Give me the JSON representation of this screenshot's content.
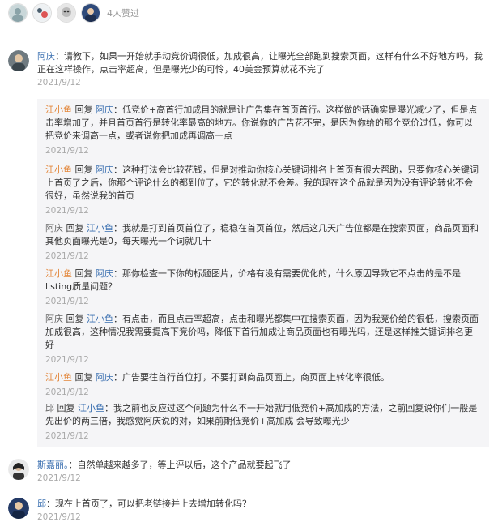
{
  "liked": {
    "text": "4人赞过",
    "avatars": [
      "avatar-1",
      "avatar-2",
      "avatar-3",
      "avatar-4"
    ]
  },
  "comments": [
    {
      "author": "阿庆",
      "text": "：请教下，如果一开始就手动竞价调很低，加成很高，让曝光全部跑到搜索页面，这样有什么不好地方吗，我正在这样操作，点击率超高，但是曝光少的可怜，40美金预算就花不完了",
      "date": "2021/9/12"
    },
    {
      "author": "斯嘉丽。",
      "text": "：自然单越来越多了，等上评以后，这个产品就要起飞了",
      "date": "2021/9/12"
    },
    {
      "author": "邱",
      "text": "：现在上首页了，可以把老链接并上去增加转化吗？",
      "date": "2021/9/12"
    }
  ],
  "replies": [
    {
      "from": "江小鱼",
      "verb": "回复",
      "to": "阿庆",
      "text": "：低竞价+高首行加成目的就是让广告集在首页首行。这样做的话确实是曝光减少了，但是点击率增加了，并且首页首行是转化率最高的地方。你说你的广告花不完，是因为你给的那个竞价过低，你可以把竞价来调高一点，或者说你把加成再调高一点",
      "date": "2021/9/12"
    },
    {
      "from": "江小鱼",
      "verb": "回复",
      "to": "阿庆",
      "text": "：这种打法会比较花钱，但是对推动你核心关键词排名上首页有很大帮助，只要你核心关键词上首页了之后，你那个评论什么的都到位了，它的转化就不会差。我的现在这个品就是因为没有评论转化不会很好，虽然说我的首页",
      "date": "2021/9/12"
    },
    {
      "from": "阿庆",
      "verb": "回复",
      "to": "江小鱼",
      "text": "：我就是打到首页首位了，稳稳在首页首位，然后这几天广告位都是在搜索页面，商品页面和其他页面曝光是0，每天曝光一个词就几十",
      "date": "2021/9/12"
    },
    {
      "from": "江小鱼",
      "verb": "回复",
      "to": "阿庆",
      "text": "：那你检查一下你的标题图片，价格有没有需要优化的，什么原因导致它不点击的是不是listing质量问题？",
      "date": "2021/9/12"
    },
    {
      "from": "阿庆",
      "verb": "回复",
      "to": "江小鱼",
      "text": "：有点击，而且点击率超高，点击和曝光都集中在搜索页面，因为我竞价给的很低，搜索页面加成很高，这种情况我需要提高下竞价吗，降低下首行加成让商品页面也有曝光吗，还是这样推关键词排名更好",
      "date": "2021/9/12"
    },
    {
      "from": "江小鱼",
      "verb": "回复",
      "to": "阿庆",
      "text": "：广告要往首行首位打，不要打到商品页面上，商页面上转化率很低。",
      "date": "2021/9/12"
    },
    {
      "from": "邱",
      "verb": "回复",
      "to": "江小鱼",
      "text": "：我之前也反应过这个问题为什么不一开始就用低竞价+高加成的方法，之前回复说你们一般是先出价的两三倍，我感觉阿庆说的对，如果前期低竞价+高加成 会导致曝光少",
      "date": "2021/9/12"
    }
  ],
  "colors": {
    "name_blue": "#3a6fb0",
    "name_orange": "#e3873b",
    "reply_bg": "#f5f5f7"
  }
}
